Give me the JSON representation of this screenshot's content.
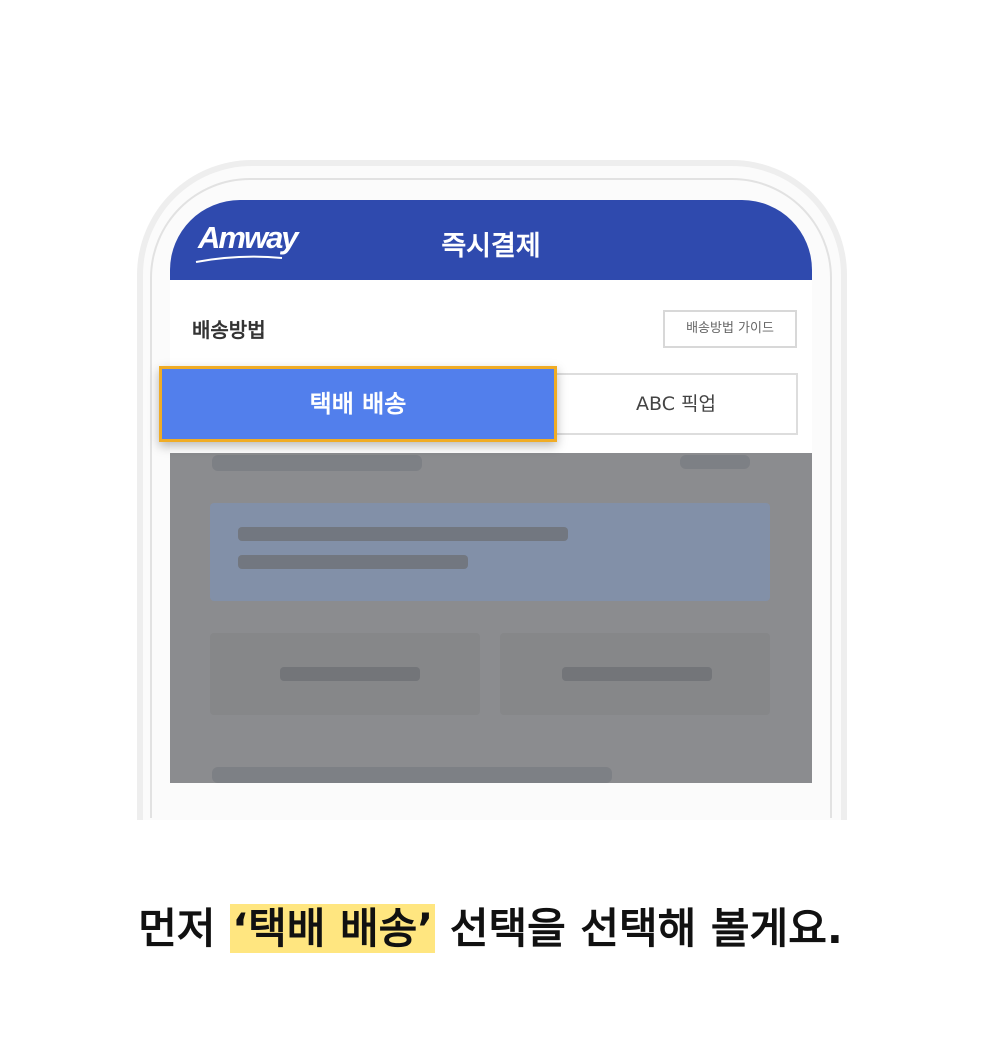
{
  "header": {
    "logo_text": "Amway",
    "title": "즉시결제",
    "color": "#2f4aae"
  },
  "delivery": {
    "section_title": "배송방법",
    "guide_button": "배송방법 가이드",
    "options": [
      {
        "label": "택배 배송",
        "selected": true,
        "color": "#527fec",
        "highlight_border": "#f0ac25"
      },
      {
        "label": "ABC 픽업",
        "selected": false
      }
    ]
  },
  "caption": {
    "prefix": "먼저 ",
    "highlight": "‘택배 배송’",
    "suffix": " 선택을 선택해 볼게요.",
    "highlight_color": "#ffe680"
  }
}
